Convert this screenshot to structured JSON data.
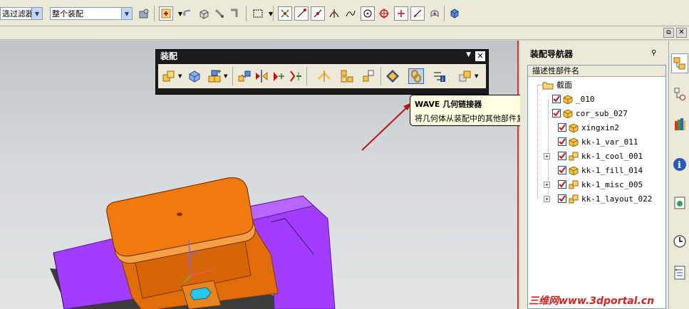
{
  "toolbar": {
    "filter_label": "选过滤器",
    "assembly_label": "整个装配",
    "icons": [
      "filter-icon",
      "assembly-icon",
      "select-icon",
      "undo-icon",
      "view-icon",
      "snap-icon",
      "snap2-icon",
      "rect-select-icon",
      "point-icon",
      "line-icon",
      "line2-icon",
      "arc-icon",
      "circle-center-icon",
      "target-icon",
      "plus-icon",
      "tangent-icon",
      "cube-icon"
    ]
  },
  "assembly_toolbar": {
    "title": "装配",
    "menu_glyph": "▼",
    "close_glyph": "✕",
    "icons": [
      "add-component-icon",
      "new-component-icon",
      "new-parent-icon",
      "create-array-icon",
      "replace-component-icon",
      "move-component-icon",
      "mate-component-icon",
      "explode-icon",
      "sequence-icon",
      "wave-geometry-linker-icon",
      "product-interface-icon",
      "reference-set-icon"
    ]
  },
  "tooltip": {
    "title": "WAVE 几何链接器",
    "description": "将几何体从装配中的其他部件复制到工作部件。"
  },
  "navigator": {
    "title": "装配导航器",
    "pin_glyph": "⚲",
    "column_header": "描述性部件名",
    "items": [
      {
        "label": "截面",
        "kind": "folder",
        "checked": false,
        "expandable": false
      },
      {
        "label": "_010",
        "kind": "part",
        "checked": true,
        "expandable": false
      },
      {
        "label": "cor_sub_027",
        "kind": "part",
        "checked": true,
        "expandable": false
      },
      {
        "label": "xingxin2",
        "kind": "part",
        "checked": true,
        "expandable": false
      },
      {
        "label": "kk-1_var_011",
        "kind": "part",
        "checked": true,
        "expandable": false
      },
      {
        "label": "kk-1_cool_001",
        "kind": "assembly",
        "checked": true,
        "expandable": true
      },
      {
        "label": "kk-1_fill_014",
        "kind": "part",
        "checked": true,
        "expandable": false
      },
      {
        "label": "kk-1_misc_005",
        "kind": "assembly",
        "checked": true,
        "expandable": true
      },
      {
        "label": "kk-1_layout_022",
        "kind": "assembly",
        "checked": true,
        "expandable": true
      }
    ]
  },
  "side_tabs": [
    "assembly-navigator-icon",
    "part-navigator-icon",
    "palette-icon",
    "info-icon",
    "web-browser-icon",
    "history-icon",
    "roles-icon"
  ],
  "watermark": "三维网www.3dportal.cn",
  "colors": {
    "accent_selected": "#c1d2ee",
    "tooltip_bg": "#ffffe1",
    "part_orange": "#f07a10",
    "base_purple": "#a23cff",
    "arrow_red": "#b01818"
  }
}
